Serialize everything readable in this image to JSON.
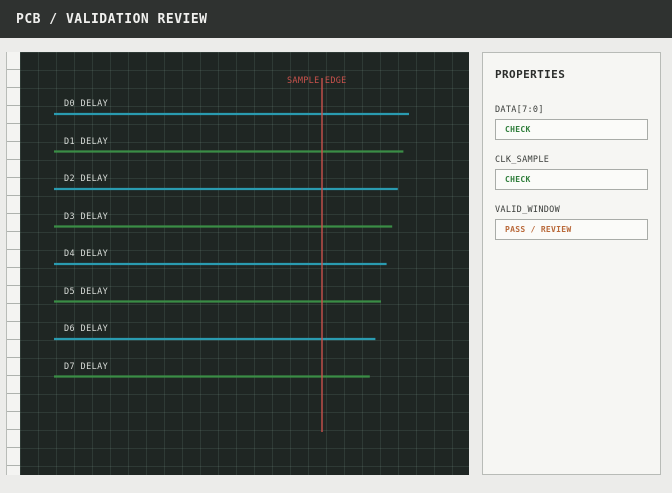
{
  "header": {
    "title": "PCB / VALIDATION REVIEW"
  },
  "board": {
    "sample_edge_label": "SAMPLE EDGE",
    "sample_edge_color": "#c9524c",
    "traces": [
      {
        "label": "D0 DELAY",
        "color": "#2a9bb0"
      },
      {
        "label": "D1 DELAY",
        "color": "#3a8d46"
      },
      {
        "label": "D2 DELAY",
        "color": "#2a9bb0"
      },
      {
        "label": "D3 DELAY",
        "color": "#3a8d46"
      },
      {
        "label": "D4 DELAY",
        "color": "#2a9bb0"
      },
      {
        "label": "D5 DELAY",
        "color": "#3a8d46"
      },
      {
        "label": "D6 DELAY",
        "color": "#2a9bb0"
      },
      {
        "label": "D7 DELAY",
        "color": "#3a8d46"
      }
    ]
  },
  "properties": {
    "title": "PROPERTIES",
    "items": [
      {
        "label": "DATA[7:0]",
        "value": "CHECK",
        "color": "#2e7d3a"
      },
      {
        "label": "CLK_SAMPLE",
        "value": "CHECK",
        "color": "#2e7d3a"
      },
      {
        "label": "VALID_WINDOW",
        "value": "PASS / REVIEW",
        "color": "#b9693a"
      }
    ]
  }
}
